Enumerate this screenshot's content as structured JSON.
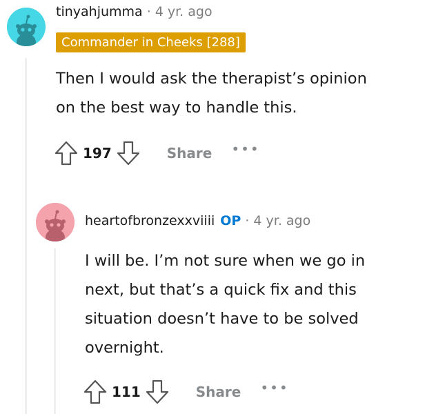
{
  "comments": [
    {
      "username": "tinyahjumma",
      "separator": "·",
      "time": "4 yr. ago",
      "flair": "Commander in Cheeks [288]",
      "body_lines": [
        "Then I would ask the therapist’s opinion",
        "on the best way to handle this."
      ],
      "score": "197",
      "share_label": "Share",
      "more_label": "•••",
      "avatar_color": "#46d7e6"
    },
    {
      "username": "heartofbronzexxviiii",
      "op_label": "OP",
      "separator": "·",
      "time": "4 yr. ago",
      "body_lines": [
        "I will be. I’m not sure when we go in",
        "next, but that’s a quick fix and this",
        "situation doesn’t have to be solved",
        "overnight."
      ],
      "score": "111",
      "share_label": "Share",
      "more_label": "•••",
      "avatar_color": "#f4a2ab"
    }
  ],
  "colors": {
    "flair_bg": "#dc9e00",
    "op": "#0079d3",
    "meta_gray": "#7c7c7c",
    "action_gray": "#878a8c",
    "thread_line": "#edeff1"
  },
  "icons": {
    "upvote": "upvote-arrow-icon",
    "downvote": "downvote-arrow-icon",
    "avatar": "snoo-avatar-icon"
  }
}
